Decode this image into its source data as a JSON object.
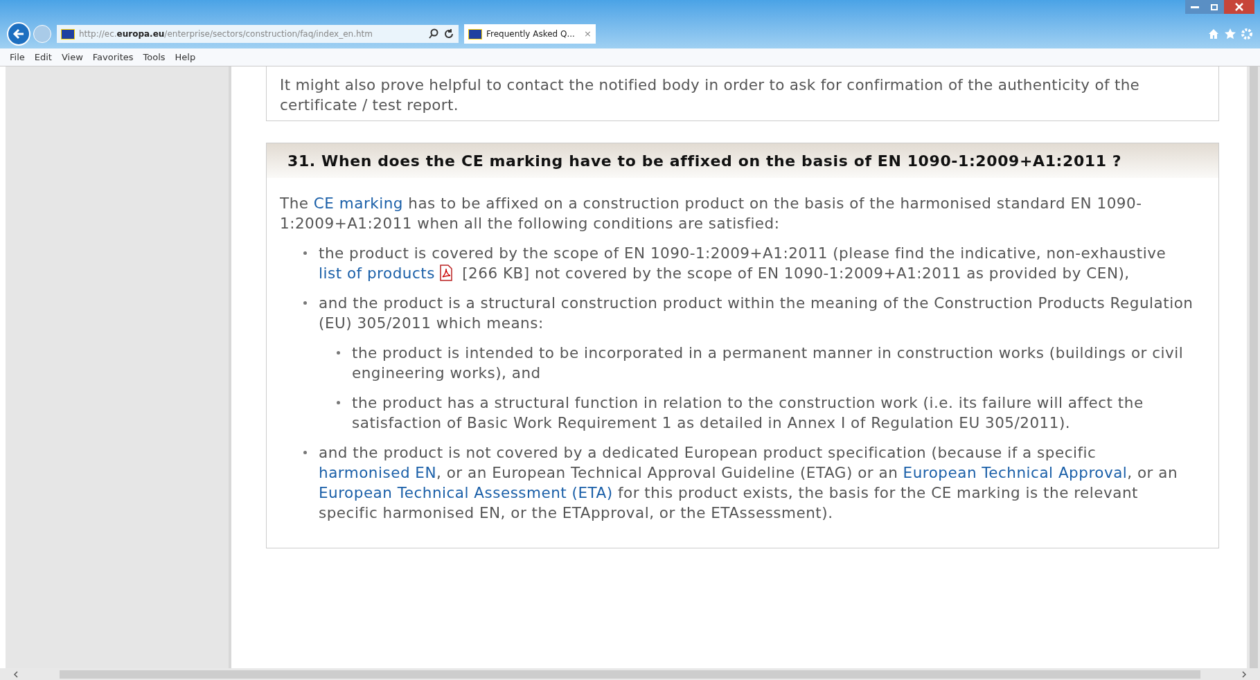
{
  "browser": {
    "url": "http://ec.**europa.eu**/enterprise/sectors/construction/faq/index_en.htm",
    "tab": {
      "title": "Frequently Asked Q...",
      "close": "×"
    }
  },
  "menu": [
    "File",
    "Edit",
    "View",
    "Favorites",
    "Tools",
    "Help"
  ],
  "intro": "It might also prove helpful to contact the notified body in order to ask for confirmation of the authenticity of the certificate / test report.",
  "faq": {
    "question": "31. When does the CE marking have to be affixed on the basis of EN 1090-1:2009+A1:2011 ?",
    "lead": [
      {
        "kind": "text",
        "text": "The "
      },
      {
        "kind": "link",
        "text": "CE marking"
      },
      {
        "kind": "text",
        "text": " has to be affixed on a construction product on the basis of the harmonised standard EN 1090-1:2009+A1:2011 when all the following conditions are satisfied:"
      }
    ],
    "items": [
      {
        "segments": [
          {
            "kind": "text",
            "text": "the product is covered by the scope of EN 1090-1:2009+A1:2011 (please find the indicative, non-exhaustive "
          },
          {
            "kind": "link",
            "text": "list of products"
          },
          {
            "kind": "pdf"
          },
          {
            "kind": "text",
            "text": " [266 KB] not covered by the scope of EN 1090-1:2009+A1:2011 as provided by CEN),"
          }
        ]
      },
      {
        "segments": [
          {
            "kind": "text",
            "text": "and the product is a structural construction product within the meaning of the Construction Products Regulation (EU) 305/2011 which means:"
          }
        ],
        "children": [
          {
            "segments": [
              {
                "kind": "text",
                "text": "the product is intended to be incorporated in a permanent manner in construction works (buildings or civil engineering works), and"
              }
            ]
          },
          {
            "segments": [
              {
                "kind": "text",
                "text": "the product has a structural function in relation to the construction work (i.e. its failure will affect the satisfaction of Basic Work Requirement 1 as detailed in Annex I of Regulation EU 305/2011)."
              }
            ]
          }
        ]
      },
      {
        "segments": [
          {
            "kind": "text",
            "text": "and the product is not covered by a dedicated European product specification (because if a specific "
          },
          {
            "kind": "link",
            "text": "harmonised EN"
          },
          {
            "kind": "text",
            "text": ", or an European Technical Approval Guideline (ETAG) or an "
          },
          {
            "kind": "link",
            "text": "European Technical Approval"
          },
          {
            "kind": "text",
            "text": ", or an "
          },
          {
            "kind": "link",
            "text": "European Technical Assessment (ETA)"
          },
          {
            "kind": "text",
            "text": " for this product exists, the basis for the CE marking is the relevant specific harmonised EN, or the ETApproval, or the ETAssessment)."
          }
        ]
      }
    ]
  }
}
